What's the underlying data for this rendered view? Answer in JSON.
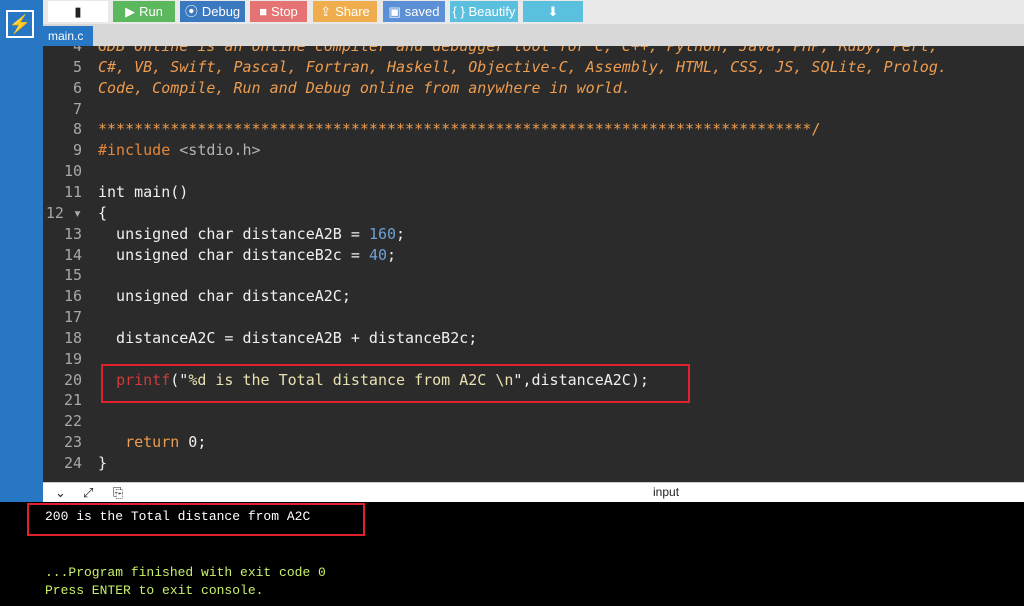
{
  "app": {
    "logo_glyph": "⚡"
  },
  "toolbar": {
    "buttons": [
      {
        "id": "file",
        "label": "",
        "icon": "file-icon",
        "glyph": "▮"
      },
      {
        "id": "run",
        "label": "Run",
        "icon": "play-icon",
        "glyph": "▶"
      },
      {
        "id": "debug",
        "label": "Debug",
        "icon": "debug-icon",
        "glyph": "⦿"
      },
      {
        "id": "stop",
        "label": "Stop",
        "icon": "stop-icon",
        "glyph": "■"
      },
      {
        "id": "share",
        "label": "Share",
        "icon": "share-icon",
        "glyph": "⇪"
      },
      {
        "id": "save",
        "label": "saved",
        "icon": "save-icon",
        "glyph": "▣"
      },
      {
        "id": "beautify",
        "label": "{ } Beautify",
        "icon": "",
        "glyph": ""
      },
      {
        "id": "download",
        "label": "",
        "icon": "download-icon",
        "glyph": "⬇"
      }
    ],
    "colors": {
      "file": "#ffffff",
      "run": "#5cb85c",
      "debug": "#3a78c0",
      "stop": "#e57373",
      "share": "#f0ad4e",
      "save": "#5b8fd6",
      "beautify": "#5bc0de",
      "download": "#5bc0de"
    }
  },
  "tabs": [
    {
      "label": "main.c",
      "active": true
    }
  ],
  "editor": {
    "lines": [
      {
        "num": "4",
        "segments": [
          {
            "t": "GDB Online is an online compiler and debugger tool for C, C++, Python, Java, PHP, Ruby, Perl,",
            "c": "cmt"
          }
        ]
      },
      {
        "num": "5",
        "segments": [
          {
            "t": "C#, VB, Swift, Pascal, Fortran, Haskell, Objective-C, Assembly, HTML, CSS, JS, SQLite, Prolog.",
            "c": "cmt"
          }
        ]
      },
      {
        "num": "6",
        "segments": [
          {
            "t": "Code, Compile, Run and Debug online from anywhere in world.",
            "c": "cmt"
          }
        ]
      },
      {
        "num": "7",
        "segments": []
      },
      {
        "num": "8",
        "segments": [
          {
            "t": "*******************************************************************************/",
            "c": "cmt-plain"
          }
        ]
      },
      {
        "num": "9",
        "segments": [
          {
            "t": "#include ",
            "c": "inc"
          },
          {
            "t": "<stdio.h>",
            "c": "inc-file"
          }
        ]
      },
      {
        "num": "10",
        "segments": []
      },
      {
        "num": "11",
        "segments": [
          {
            "t": "int main()",
            "c": "kw"
          }
        ]
      },
      {
        "num": "12 ▾",
        "segments": [
          {
            "t": "{",
            "c": "kw"
          }
        ]
      },
      {
        "num": "13",
        "segments": [
          {
            "t": "  unsigned char distanceA2B ",
            "c": "kw"
          },
          {
            "t": "= ",
            "c": "kw"
          },
          {
            "t": "160",
            "c": "num"
          },
          {
            "t": ";",
            "c": "kw"
          }
        ]
      },
      {
        "num": "14",
        "segments": [
          {
            "t": "  unsigned char distanceB2c ",
            "c": "kw"
          },
          {
            "t": "= ",
            "c": "kw"
          },
          {
            "t": "40",
            "c": "num"
          },
          {
            "t": ";",
            "c": "kw"
          }
        ]
      },
      {
        "num": "15",
        "segments": []
      },
      {
        "num": "16",
        "segments": [
          {
            "t": "  unsigned char distanceA2C;",
            "c": "kw"
          }
        ]
      },
      {
        "num": "17",
        "segments": []
      },
      {
        "num": "18",
        "segments": [
          {
            "t": "  distanceA2C = distanceA2B + distanceB2c;",
            "c": "kw"
          }
        ]
      },
      {
        "num": "19",
        "segments": []
      },
      {
        "num": "20",
        "segments": [
          {
            "t": "  ",
            "c": "kw"
          },
          {
            "t": "printf",
            "c": "fn"
          },
          {
            "t": "(\"",
            "c": "kw"
          },
          {
            "t": "%d is the Total distance from A2C \\n",
            "c": "str"
          },
          {
            "t": "\",distanceA2C);",
            "c": "kw"
          }
        ]
      },
      {
        "num": "21",
        "segments": []
      },
      {
        "num": "22",
        "segments": []
      },
      {
        "num": "23",
        "segments": [
          {
            "t": "   ",
            "c": "kw"
          },
          {
            "t": "return",
            "c": "ret"
          },
          {
            "t": " 0;",
            "c": "kw"
          }
        ]
      },
      {
        "num": "24",
        "segments": [
          {
            "t": "}",
            "c": "kw"
          }
        ]
      }
    ]
  },
  "panel": {
    "title": "input",
    "icons": [
      {
        "name": "collapse-icon",
        "glyph": "⌄"
      },
      {
        "name": "expand-icon",
        "glyph": "⤢"
      },
      {
        "name": "copy-icon",
        "glyph": "⎘"
      }
    ]
  },
  "console": {
    "lines": [
      {
        "text": "200 is the Total distance from A2C",
        "color": "#ffffff"
      },
      {
        "text": "",
        "color": "#ffffff"
      },
      {
        "text": "",
        "color": "#ffffff"
      },
      {
        "text": "...Program finished with exit code 0",
        "color": "#c8f06a"
      },
      {
        "text": "Press ENTER to exit console.",
        "color": "#c8f06a"
      }
    ]
  },
  "colors": {
    "accent": "#2777c4",
    "highlight": "#e0202a"
  }
}
